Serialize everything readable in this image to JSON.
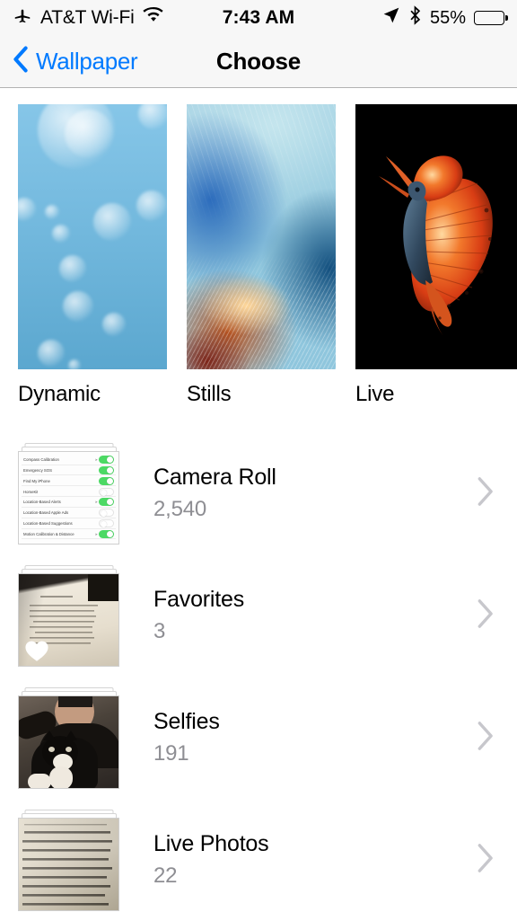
{
  "status_bar": {
    "airplane_icon": "airplane-icon",
    "carrier": "AT&T Wi-Fi",
    "wifi_icon": "wifi-icon",
    "time": "7:43 AM",
    "location_icon": "location-arrow-icon",
    "bluetooth_icon": "bluetooth-icon",
    "battery_percent": "55%",
    "battery_level": 55
  },
  "nav_bar": {
    "back_label": "Wallpaper",
    "back_icon": "chevron-left-icon",
    "title": "Choose",
    "accent_color": "#007AFF"
  },
  "wallpaper_types": [
    {
      "label": "Dynamic",
      "thumb": "dynamic-bokeh-blue"
    },
    {
      "label": "Stills",
      "thumb": "stills-ice-water"
    },
    {
      "label": "Live",
      "thumb": "live-betta-fish"
    }
  ],
  "albums": [
    {
      "name": "Camera Roll",
      "count": "2,540",
      "thumb": "settings-screenshot",
      "chevron": "chevron-right-icon"
    },
    {
      "name": "Favorites",
      "count": "3",
      "thumb": "open-book",
      "badge": "heart-icon",
      "chevron": "chevron-right-icon"
    },
    {
      "name": "Selfies",
      "count": "191",
      "thumb": "person-with-cat",
      "chevron": "chevron-right-icon"
    },
    {
      "name": "Live Photos",
      "count": "22",
      "thumb": "book-page-cairo",
      "chevron": "chevron-right-icon"
    }
  ],
  "camera_roll_thumb_rows": [
    {
      "label": "Compass Calibration",
      "toggle": "on",
      "arrow": true
    },
    {
      "label": "Emergency SOS",
      "toggle": "on",
      "arrow": false
    },
    {
      "label": "Find My iPhone",
      "toggle": "on",
      "arrow": false
    },
    {
      "label": "HomeKit",
      "toggle": "off",
      "arrow": false
    },
    {
      "label": "Location-Based Alerts",
      "toggle": "on",
      "arrow": true
    },
    {
      "label": "Location-Based Apple Ads",
      "toggle": "off",
      "arrow": false
    },
    {
      "label": "Location-Based Suggestions",
      "toggle": "off",
      "arrow": false
    },
    {
      "label": "Motion Calibration & Distance",
      "toggle": "on",
      "arrow": true
    }
  ],
  "colors": {
    "nav_background": "#F7F7F7",
    "body_background": "#FFFFFF",
    "secondary_text": "#8E8E93",
    "chevron": "#C7C7CC",
    "toggle_on": "#4CD964"
  }
}
